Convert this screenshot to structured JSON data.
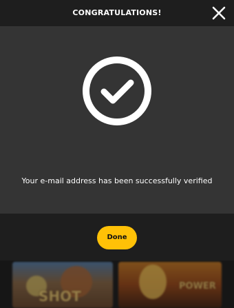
{
  "modal": {
    "title": "CONGRATULATIONS!",
    "message": "Your e-mail address has been successfully verified",
    "done_label": "Done",
    "close_icon": "close-icon",
    "success_icon": "check-circle-icon"
  },
  "background_games": [
    {
      "title": "SHOT",
      "icon": "game-thumbnail"
    },
    {
      "title": "POWER",
      "icon": "game-thumbnail"
    }
  ],
  "colors": {
    "header_bg": "#1e1e1e",
    "body_bg": "#343434",
    "accent": "#ffc107",
    "text": "#ffffff"
  }
}
